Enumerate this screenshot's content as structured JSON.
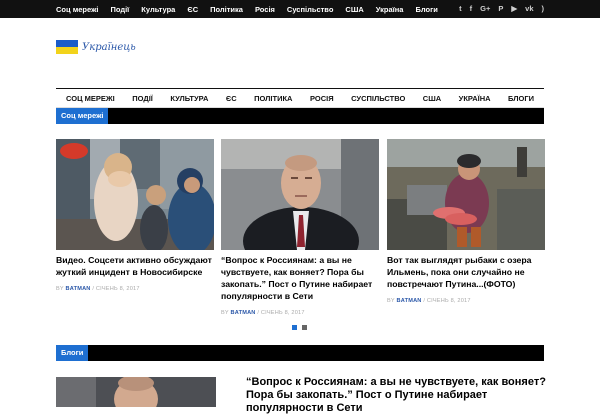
{
  "top_menu": [
    "Соц мережі",
    "Події",
    "Культура",
    "ЄС",
    "Політика",
    "Росія",
    "Суспільство",
    "США",
    "Україна",
    "Блоги"
  ],
  "social_icons": [
    "twitter-icon",
    "facebook-icon",
    "google-plus-icon",
    "pinterest-icon",
    "youtube-icon",
    "vk-icon",
    "rss-icon"
  ],
  "social_glyphs": [
    "t",
    "f",
    "G+",
    "P",
    "▶",
    "vk",
    ")"
  ],
  "logo": {
    "text": "Українець",
    "flag_colors": [
      "#1b5cc9",
      "#f2d31b"
    ]
  },
  "main_menu": [
    "СОЦ МЕРЕЖІ",
    "ПОДІЇ",
    "КУЛЬТУРА",
    "ЄС",
    "ПОЛІТИКА",
    "РОСІЯ",
    "СУСПІЛЬСТВО",
    "США",
    "УКРАЇНА",
    "БЛОГИ"
  ],
  "section_social": {
    "label": "Соц мережі"
  },
  "articles": [
    {
      "title": "Видео. Соцсети активно обсуждают жуткий инцидент в Новосибирске",
      "by": "BY",
      "author": "BATMAN",
      "sep": "/",
      "date": "СІЧЕНЬ 8, 2017"
    },
    {
      "title": "“Вопрос к Россиянам: а вы не чувствуете, как воняет? Пора бы закопать.” Пост о Путине набирает популярности в Сети",
      "by": "BY",
      "author": "BATMAN",
      "sep": "/",
      "date": "СІЧЕНЬ 8, 2017"
    },
    {
      "title": "Вот так выглядят рыбаки с озера Ильмень, пока они случайно не повстречают Путина...(ФОТО)",
      "by": "BY",
      "author": "BATMAN",
      "sep": "/",
      "date": "СІЧЕНЬ 8, 2017"
    }
  ],
  "slider": {
    "total": 2,
    "active_index": 0
  },
  "section_blogs": {
    "label": "Блоги"
  },
  "blog_post": {
    "title": "“Вопрос к Россиянам: а вы не чувствуете, как воняет? Пора бы закопать.” Пост о Путине набирает популярности в Сети"
  },
  "colors": {
    "accent": "#1e6fd1",
    "bar": "#000000",
    "author": "#2a57a8"
  }
}
